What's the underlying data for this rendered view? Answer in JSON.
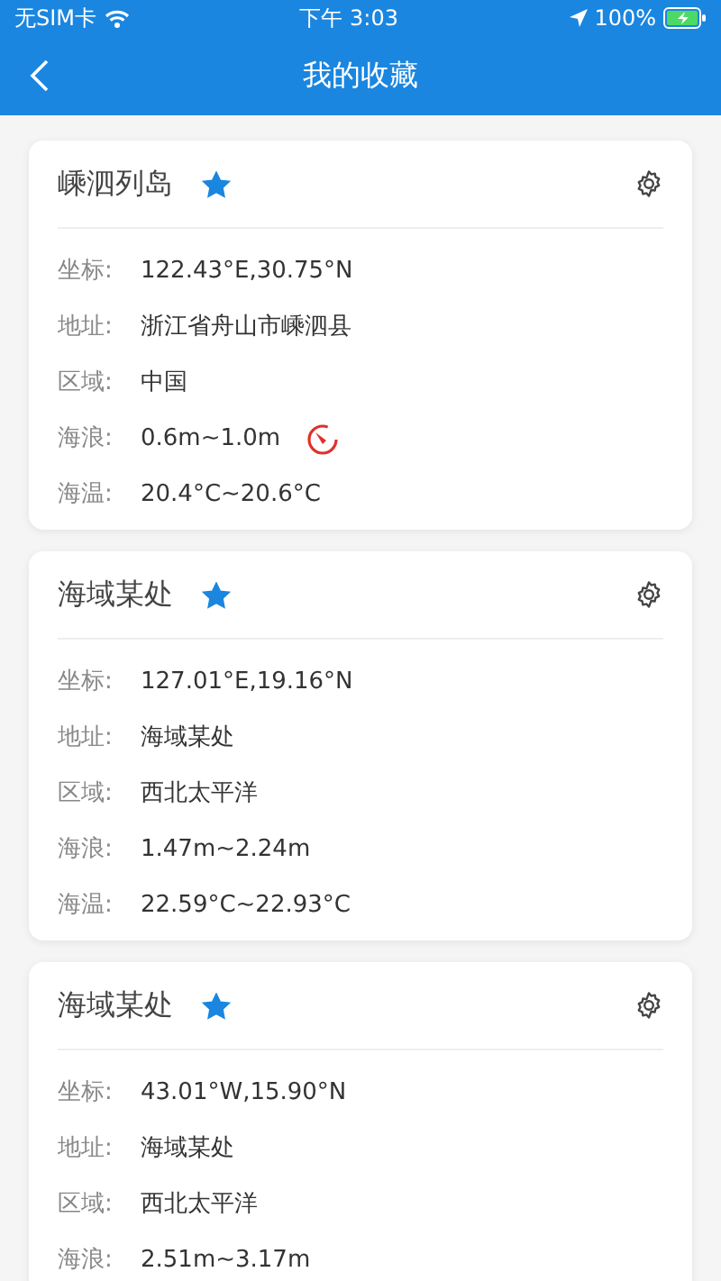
{
  "status_bar": {
    "carrier": "无SIM卡",
    "time": "下午 3:03",
    "battery": "100%",
    "charging": true
  },
  "header": {
    "title": "我的收藏"
  },
  "favorites": [
    {
      "name": "嵊泗列岛",
      "starred": true,
      "rows": [
        {
          "label": "坐标:",
          "value": "122.43°E,30.75°N",
          "alert": false
        },
        {
          "label": "地址:",
          "value": "浙江省舟山市嵊泗县",
          "alert": false
        },
        {
          "label": "区域:",
          "value": "中国",
          "alert": false
        },
        {
          "label": "海浪:",
          "value": "0.6m~1.0m",
          "alert": true
        },
        {
          "label": "海温:",
          "value": "20.4°C~20.6°C",
          "alert": false
        }
      ]
    },
    {
      "name": "海域某处",
      "starred": true,
      "rows": [
        {
          "label": "坐标:",
          "value": "127.01°E,19.16°N",
          "alert": false
        },
        {
          "label": "地址:",
          "value": "海域某处",
          "alert": false
        },
        {
          "label": "区域:",
          "value": "西北太平洋",
          "alert": false
        },
        {
          "label": "海浪:",
          "value": "1.47m~2.24m",
          "alert": false
        },
        {
          "label": "海温:",
          "value": "22.59°C~22.93°C",
          "alert": false
        }
      ]
    },
    {
      "name": "海域某处",
      "starred": true,
      "rows": [
        {
          "label": "坐标:",
          "value": "43.01°W,15.90°N",
          "alert": false
        },
        {
          "label": "地址:",
          "value": "海域某处",
          "alert": false
        },
        {
          "label": "区域:",
          "value": "西北太平洋",
          "alert": false
        },
        {
          "label": "海浪:",
          "value": "2.51m~3.17m",
          "alert": false
        }
      ]
    }
  ]
}
